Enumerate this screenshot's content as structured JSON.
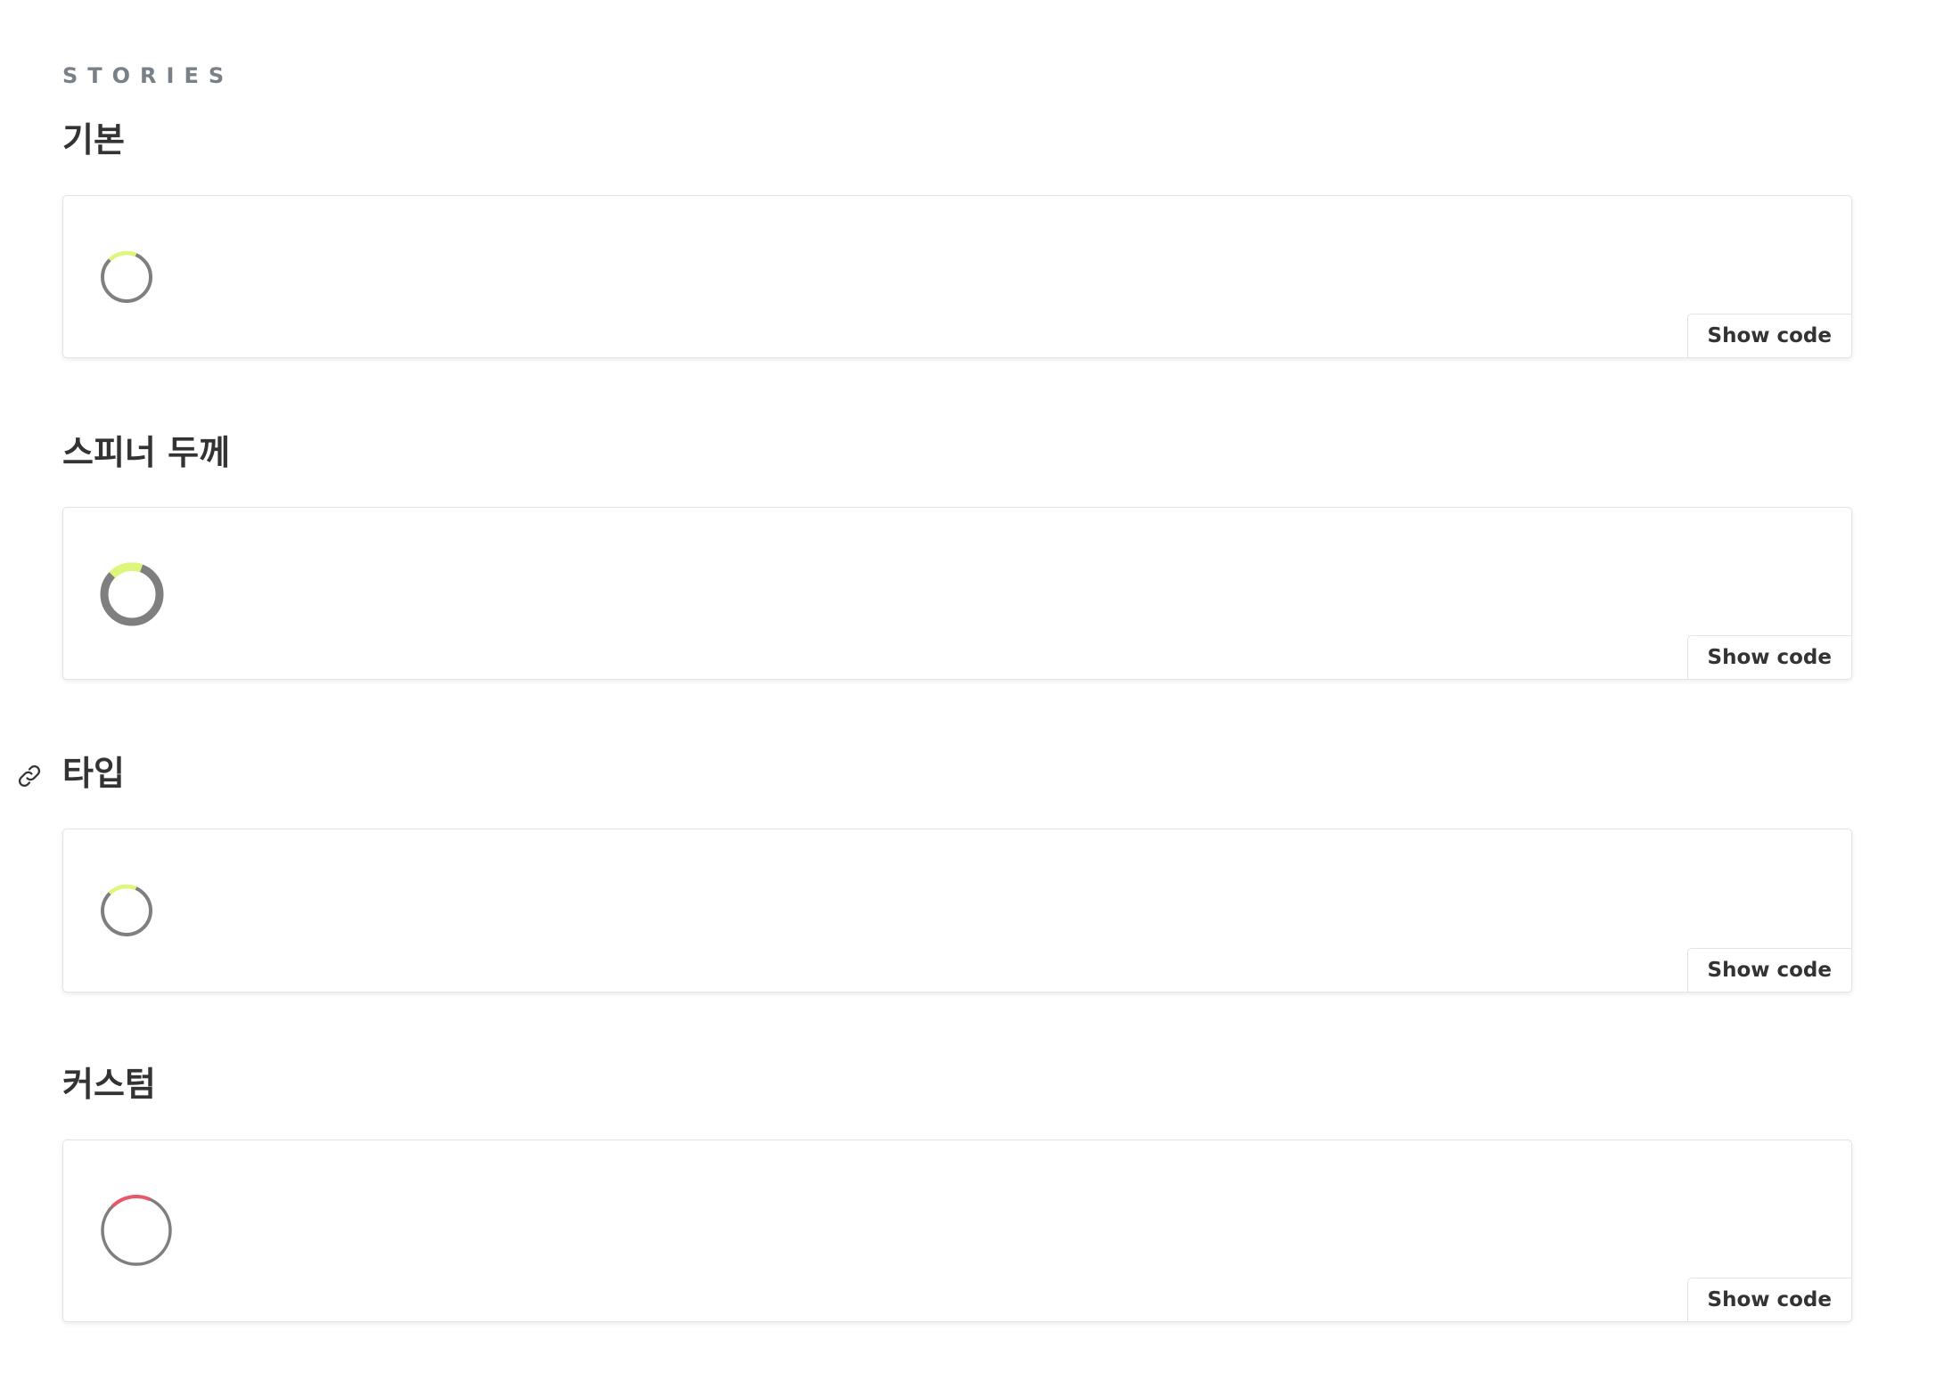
{
  "section_label": "STORIES",
  "colors": {
    "spinner_track": "#7f7f7f",
    "spinner_accent": "#ddf77a",
    "spinner_custom_accent": "#e8576a"
  },
  "stories": [
    {
      "title": "기본",
      "show_code_label": "Show code",
      "spinner": "default"
    },
    {
      "title": "스피너 두께",
      "show_code_label": "Show code",
      "spinner": "thick"
    },
    {
      "title": "타입",
      "show_code_label": "Show code",
      "spinner": "default",
      "has_anchor_icon": true
    },
    {
      "title": "커스텀",
      "show_code_label": "Show code",
      "spinner": "custom"
    }
  ]
}
